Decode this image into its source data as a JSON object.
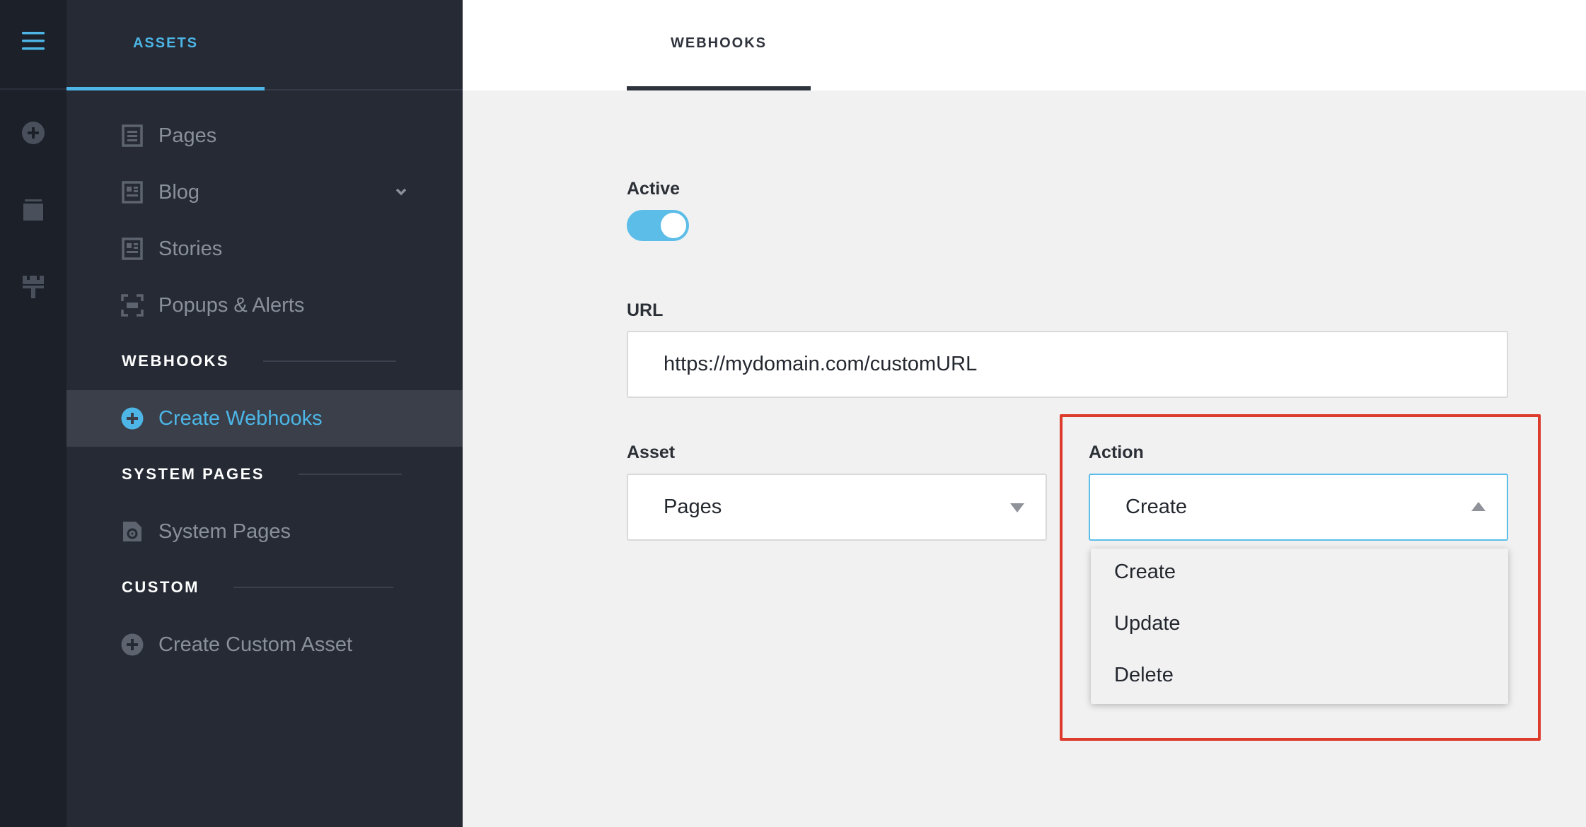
{
  "rail": {
    "menu_icon": "hamburger-menu-icon",
    "icons": [
      "add-circle-icon",
      "layers-icon",
      "paint-roller-icon"
    ]
  },
  "sidebar": {
    "tab_label": "ASSETS",
    "items": [
      {
        "label": "Pages",
        "icon": "page-icon"
      },
      {
        "label": "Blog",
        "icon": "blog-icon"
      },
      {
        "label": "Stories",
        "icon": "stories-icon"
      },
      {
        "label": "Popups & Alerts",
        "icon": "popup-icon"
      }
    ],
    "sections": {
      "webhooks": "WEBHOOKS",
      "system_pages": "SYSTEM PAGES",
      "custom": "CUSTOM"
    },
    "create_webhooks": "Create Webhooks",
    "system_pages_item": "System Pages",
    "create_custom_asset": "Create Custom Asset",
    "accent_color": "#4db6e6"
  },
  "main": {
    "tab_label": "WEBHOOKS",
    "active_label": "Active",
    "active_on": true,
    "url_label": "URL",
    "url_value": "https://mydomain.com/customURL",
    "asset_label": "Asset",
    "asset_value": "Pages",
    "action_label": "Action",
    "action_value": "Create",
    "action_options": [
      "Create",
      "Update",
      "Delete"
    ],
    "highlight_color": "#dd3b2c"
  }
}
